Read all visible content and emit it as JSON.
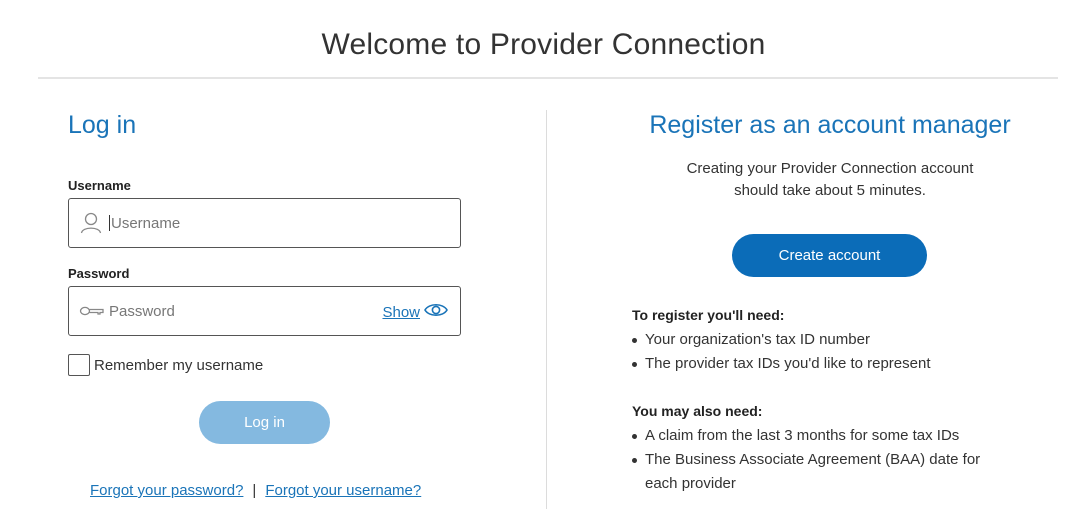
{
  "page": {
    "title": "Welcome to Provider Connection"
  },
  "login": {
    "heading": "Log in",
    "username_label": "Username",
    "username_placeholder": "Username",
    "username_value": "",
    "password_label": "Password",
    "password_placeholder": "Password",
    "password_value": "",
    "show_label": "Show",
    "remember_label": "Remember my username",
    "remember_checked": false,
    "login_button": "Log in",
    "forgot_password": "Forgot your password?",
    "separator": "|",
    "forgot_username": "Forgot your username?",
    "icons": {
      "username": "person-icon",
      "password": "key-icon",
      "show": "eye-icon"
    }
  },
  "register": {
    "heading": "Register as an account manager",
    "intro_line1": "Creating your Provider Connection account",
    "intro_line2": "should take about 5 minutes.",
    "create_button": "Create account",
    "need_heading": "To register you'll need:",
    "need_items": [
      "Your organization's tax ID number",
      "The provider tax IDs you'd like to represent"
    ],
    "also_heading": "You may also need:",
    "also_items": [
      "A claim from the last 3 months for some tax IDs",
      "The Business Associate Agreement (BAA) date for each provider"
    ]
  },
  "colors": {
    "accent": "#1a74b8",
    "primary_button": "#0b6cb8",
    "disabled_button": "#84b9e0"
  }
}
